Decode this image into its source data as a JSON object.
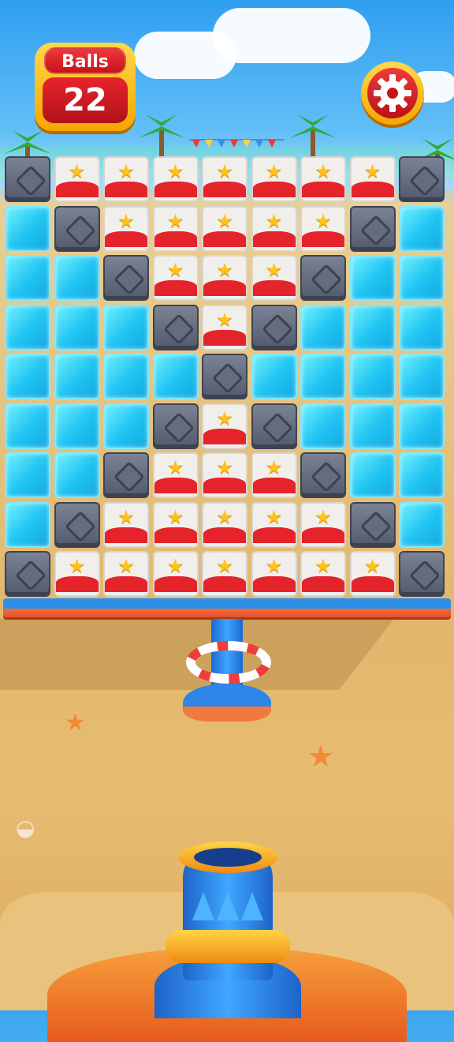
{
  "hud": {
    "balls_label": "Balls",
    "balls_count": "22",
    "settings_icon": "gear-icon"
  },
  "board": {
    "rows": [
      [
        "stone",
        "star",
        "star",
        "star",
        "star",
        "star",
        "star",
        "star",
        "stone"
      ],
      [
        "ice",
        "stone",
        "star",
        "star",
        "star",
        "star",
        "star",
        "stone",
        "ice"
      ],
      [
        "ice",
        "ice",
        "stone",
        "star",
        "star",
        "star",
        "stone",
        "ice",
        "ice"
      ],
      [
        "ice",
        "ice",
        "ice",
        "stone",
        "star",
        "stone",
        "ice",
        "ice",
        "ice"
      ],
      [
        "ice",
        "ice",
        "ice",
        "ice",
        "stone",
        "ice",
        "ice",
        "ice",
        "ice"
      ],
      [
        "ice",
        "ice",
        "ice",
        "stone",
        "star",
        "stone",
        "ice",
        "ice",
        "ice"
      ],
      [
        "ice",
        "ice",
        "stone",
        "star",
        "star",
        "star",
        "stone",
        "ice",
        "ice"
      ],
      [
        "ice",
        "stone",
        "star",
        "star",
        "star",
        "star",
        "star",
        "stone",
        "ice"
      ],
      [
        "stone",
        "star",
        "star",
        "star",
        "star",
        "star",
        "star",
        "star",
        "stone"
      ]
    ]
  },
  "colors": {
    "ice": "#1fc3f2",
    "stone": "#5d6476",
    "star_block_red": "#e5232b",
    "star": "#ffc21b",
    "hud_red": "#d91c24",
    "hud_gold": "#f5a600"
  }
}
